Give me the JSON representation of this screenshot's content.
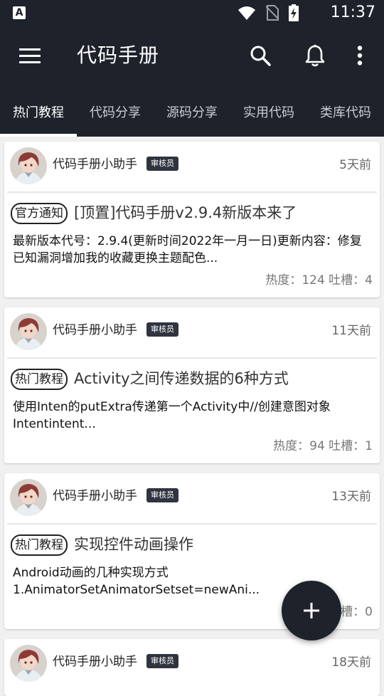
{
  "status_bar": {
    "app_icon_letter": "A",
    "time": "11:37"
  },
  "toolbar": {
    "title": "代码手册",
    "icons": [
      "menu-icon",
      "search-icon",
      "bell-icon",
      "more-vert-icon"
    ]
  },
  "tabs": [
    {
      "label": "热门教程",
      "active": true
    },
    {
      "label": "代码分享",
      "active": false
    },
    {
      "label": "源码分享",
      "active": false
    },
    {
      "label": "实用代码",
      "active": false
    },
    {
      "label": "类库代码",
      "active": false
    }
  ],
  "posts": [
    {
      "author": "代码手册小助手",
      "badge": "审核员",
      "time": "5天前",
      "tag": "官方通知",
      "title": "[顶置]代码手册v2.9.4新版本来了",
      "excerpt": "最新版本代号：2.9.4(更新时间2022年一月一日)更新内容：修复已知漏洞增加我的收藏更换主题配色...",
      "stats": "热度：124  吐槽：4"
    },
    {
      "author": "代码手册小助手",
      "badge": "审核员",
      "time": "11天前",
      "tag": "热门教程",
      "title": "Activity之间传递数据的6种方式",
      "excerpt": "使用Inten的putExtra传递第一个Activity中//创建意图对象Intentintent...",
      "stats": "热度：94  吐槽：1"
    },
    {
      "author": "代码手册小助手",
      "badge": "审核员",
      "time": "13天前",
      "tag": "热门教程",
      "title": "实现控件动画操作",
      "excerpt": "Android动画的几种实现方式1.AnimatorSetAnimatorSetset=newAni...",
      "stats": "热度：  吐槽：0"
    },
    {
      "author": "代码手册小助手",
      "badge": "审核员",
      "time": "18天前"
    }
  ],
  "fab": {
    "icon": "plus-icon"
  },
  "colors": {
    "primary": "#1e222b",
    "background": "#f0f0f0",
    "card": "#ffffff",
    "badge": "#2f343f"
  }
}
